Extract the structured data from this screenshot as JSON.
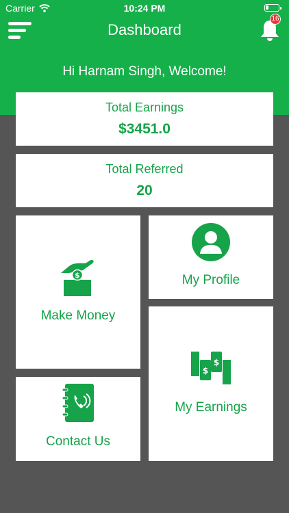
{
  "status": {
    "carrier": "Carrier",
    "time": "10:24 PM"
  },
  "header": {
    "title": "Dashboard",
    "notification_count": "16"
  },
  "welcome": "Hi Harnam Singh, Welcome!",
  "stats": {
    "earnings_label": "Total Earnings",
    "earnings_value": "$3451.0",
    "referred_label": "Total Referred",
    "referred_value": "20"
  },
  "tiles": {
    "make_money": "Make Money",
    "my_profile": "My Profile",
    "my_earnings": "My Earnings",
    "contact_us": "Contact Us"
  },
  "icons": [
    "menu-icon",
    "bell-icon",
    "wifi-icon",
    "battery-icon",
    "money-box-icon",
    "user-icon",
    "money-exchange-icon",
    "phone-book-icon"
  ],
  "colors": {
    "brand": "#16b04a",
    "text": "#16a34a",
    "background": "#555555",
    "badge": "#e53935"
  }
}
